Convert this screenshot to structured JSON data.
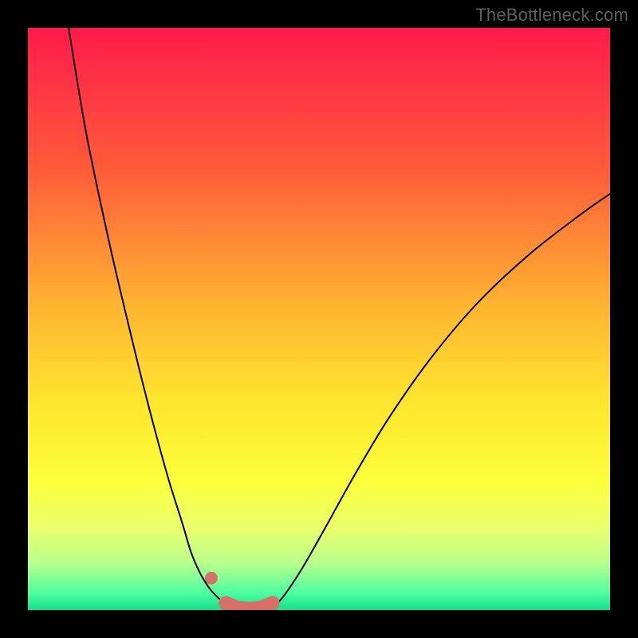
{
  "watermark": "TheBottleneck.com",
  "chart_data": {
    "type": "line",
    "title": "",
    "xlabel": "",
    "ylabel": "",
    "xlim": [
      0,
      100
    ],
    "ylim": [
      0,
      100
    ],
    "grid": false,
    "legend": false,
    "gradient_stops": [
      {
        "offset": 0,
        "color": "#ff1a4b"
      },
      {
        "offset": 0.24,
        "color": "#ff5a3a"
      },
      {
        "offset": 0.48,
        "color": "#ffb531"
      },
      {
        "offset": 0.64,
        "color": "#ffe52e"
      },
      {
        "offset": 0.78,
        "color": "#fbff3a"
      },
      {
        "offset": 0.86,
        "color": "#e9ff6d"
      },
      {
        "offset": 0.92,
        "color": "#b8ff8c"
      },
      {
        "offset": 0.97,
        "color": "#4fffa0"
      },
      {
        "offset": 1.0,
        "color": "#13e08b"
      }
    ],
    "series": [
      {
        "name": "bottleneck-curve-left",
        "x": [
          7,
          10,
          14,
          18,
          21,
          24,
          26.5,
          28,
          29.5,
          31,
          32,
          33.5,
          36.5
        ],
        "values": [
          100,
          82,
          63,
          46,
          34,
          23,
          15,
          10,
          6.5,
          4,
          2.8,
          1.5,
          0.2
        ]
      },
      {
        "name": "bottleneck-curve-right",
        "x": [
          42,
          44,
          47,
          51,
          56,
          62,
          69,
          77,
          86,
          95,
          100
        ],
        "values": [
          0.3,
          2.5,
          7,
          14,
          23,
          33,
          43,
          52.5,
          61,
          68,
          71.5
        ]
      },
      {
        "name": "bottleneck-floor",
        "x": [
          36.5,
          42
        ],
        "values": [
          0.2,
          0.3
        ]
      }
    ],
    "marker_band": {
      "color": "#d77168",
      "curve": {
        "x": [
          34,
          36,
          38,
          40,
          42
        ],
        "values": [
          1.2,
          0.4,
          0.2,
          0.4,
          1.2
        ]
      },
      "dot": {
        "x": 31.5,
        "value": 5.5
      }
    }
  }
}
